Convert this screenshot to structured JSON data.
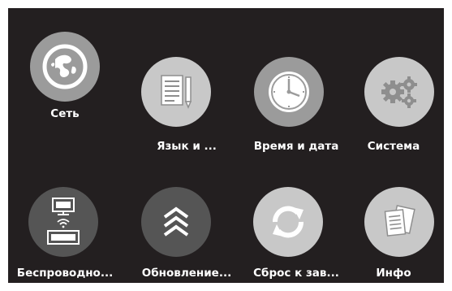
{
  "menu": {
    "items": [
      {
        "id": "network",
        "label": "Сеть",
        "icon": "globe-icon"
      },
      {
        "id": "language",
        "label": "Язык и ...",
        "icon": "notepad-icon"
      },
      {
        "id": "datetime",
        "label": "Время и дата",
        "icon": "clock-icon"
      },
      {
        "id": "system",
        "label": "Система",
        "icon": "gears-icon"
      },
      {
        "id": "wireless",
        "label": "Беспроводно...",
        "icon": "wireless-display-icon"
      },
      {
        "id": "update",
        "label": "Обновление...",
        "icon": "chevrons-up-icon"
      },
      {
        "id": "reset",
        "label": "Сброс к зав...",
        "icon": "refresh-icon"
      },
      {
        "id": "info",
        "label": "Инфо",
        "icon": "documents-icon"
      }
    ]
  }
}
